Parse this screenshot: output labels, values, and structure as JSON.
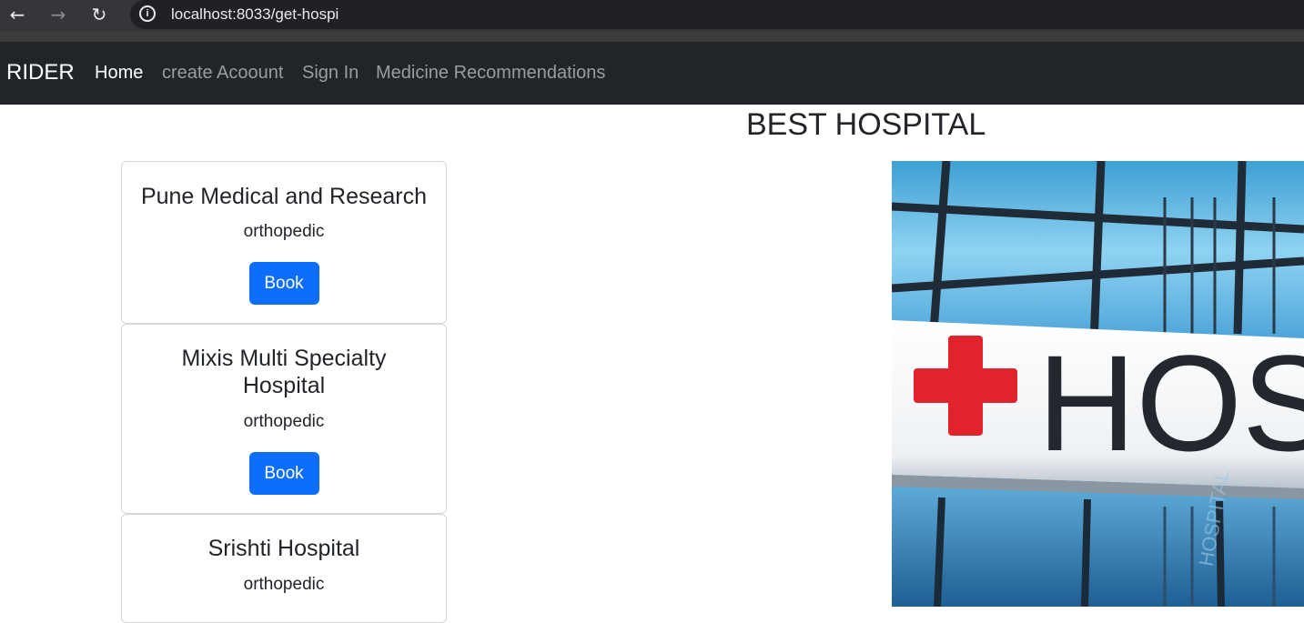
{
  "browser": {
    "url": "localhost:8033/get-hospi",
    "icons": [
      "back-arrow-icon",
      "forward-arrow-icon",
      "reload-icon",
      "info-icon"
    ]
  },
  "navbar": {
    "brand": "RIDER",
    "links": [
      {
        "label": "Home",
        "active": true
      },
      {
        "label": "create Acoount",
        "active": false
      },
      {
        "label": "Sign In",
        "active": false
      },
      {
        "label": "Medicine Recommendations",
        "active": false
      }
    ]
  },
  "main": {
    "title": "BEST HOSPITAL",
    "hospitals": [
      {
        "name": "Pune Medical and Research",
        "specialty": "orthopedic",
        "button": "Book"
      },
      {
        "name_lines": [
          "Mixis Multi Specialty",
          "Hospital"
        ],
        "specialty": "orthopedic",
        "button": "Book"
      },
      {
        "name": "Srishti Hospital",
        "specialty": "orthopedic"
      }
    ],
    "image_sign_text": "HOS",
    "image_sign_text_small": "HOSPITAL"
  },
  "colors": {
    "navbar_bg": "#212529",
    "button_bg": "#0d6efd",
    "cross_red": "#e1232b"
  }
}
